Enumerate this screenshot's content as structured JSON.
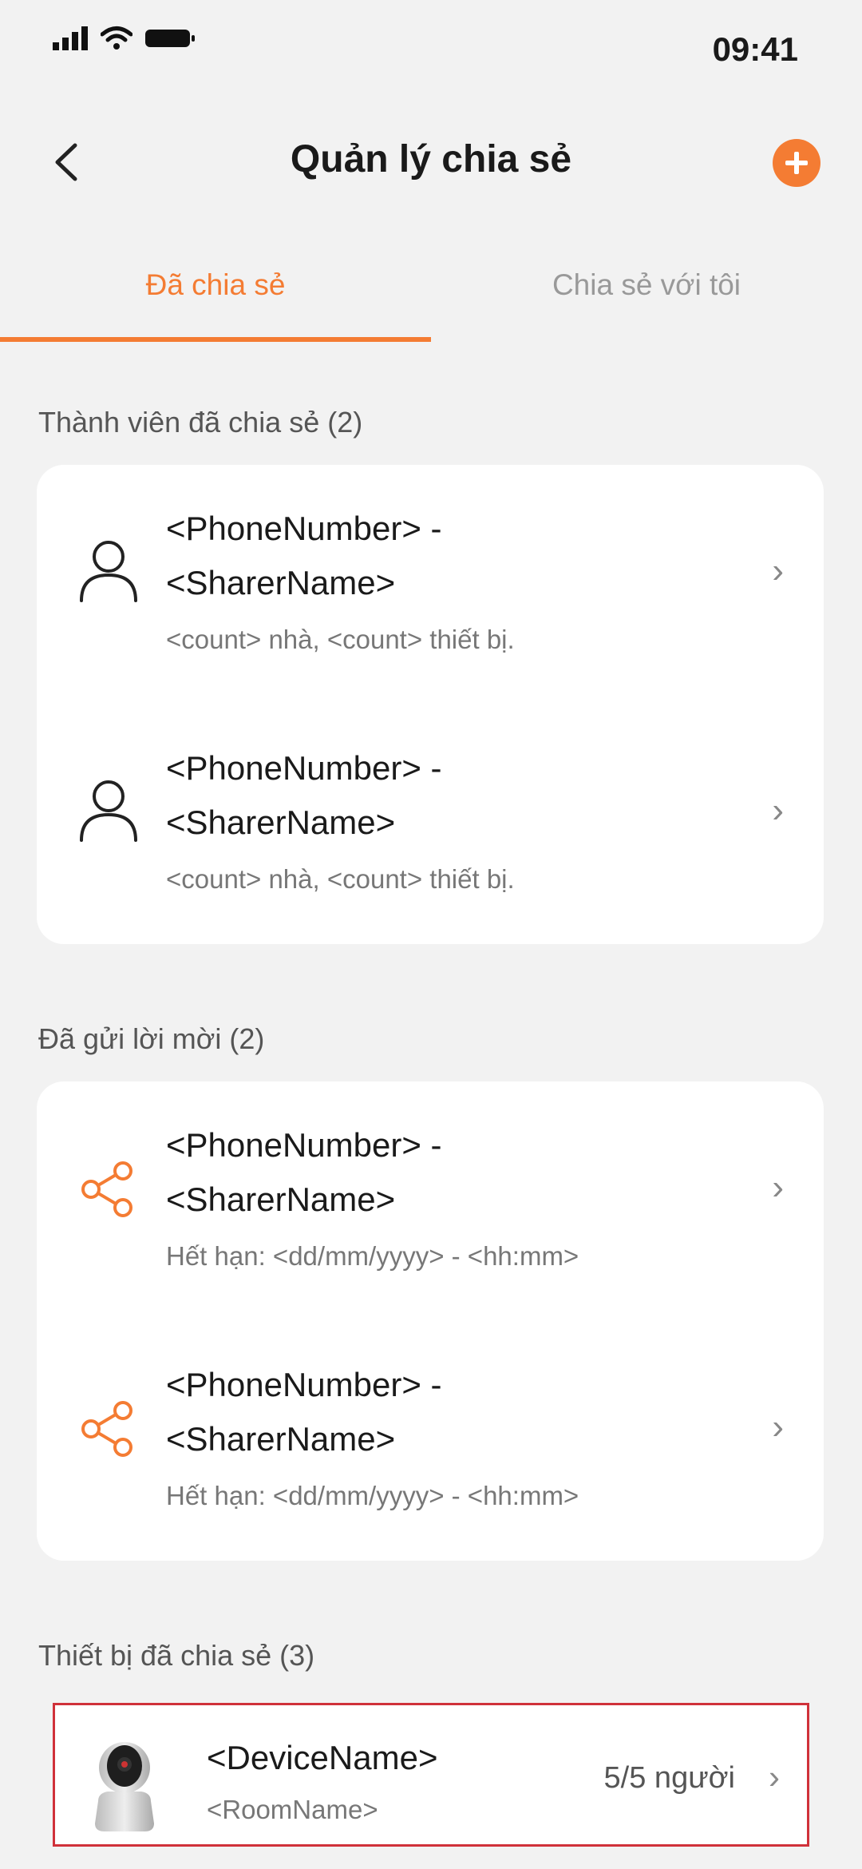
{
  "status_bar": {
    "time": "09:41"
  },
  "header": {
    "title": "Quản lý chia sẻ"
  },
  "tabs": [
    {
      "label": "Đã chia sẻ",
      "active": true
    },
    {
      "label": "Chia sẻ với tôi",
      "active": false
    }
  ],
  "members": {
    "label": "Thành viên đã chia sẻ (2)",
    "items": [
      {
        "line1": "<PhoneNumber> -",
        "line2": "<SharerName>",
        "sub": "<count> nhà, <count> thiết bị."
      },
      {
        "line1": "<PhoneNumber> -",
        "line2": "<SharerName>",
        "sub": "<count> nhà, <count> thiết bị."
      }
    ]
  },
  "invites": {
    "label": "Đã gửi lời mời (2)",
    "items": [
      {
        "line1": "<PhoneNumber> -",
        "line2": "<SharerName>",
        "sub": "Hết hạn: <dd/mm/yyyy> - <hh:mm>"
      },
      {
        "line1": "<PhoneNumber> -",
        "line2": "<SharerName>",
        "sub": "Hết hạn: <dd/mm/yyyy> - <hh:mm>"
      }
    ]
  },
  "devices": {
    "label": "Thiết bị đã chia sẻ (3)",
    "items": [
      {
        "name": "<DeviceName>",
        "room": "<RoomName>",
        "count": "5/5 người"
      }
    ]
  },
  "colors": {
    "accent": "#f47c33",
    "highlight_border": "#d0313a"
  },
  "icons": [
    "signal-icon",
    "wifi-icon",
    "battery-icon",
    "back-icon",
    "add-icon",
    "user-icon",
    "share-icon",
    "chevron-right-icon",
    "camera-device-icon"
  ]
}
